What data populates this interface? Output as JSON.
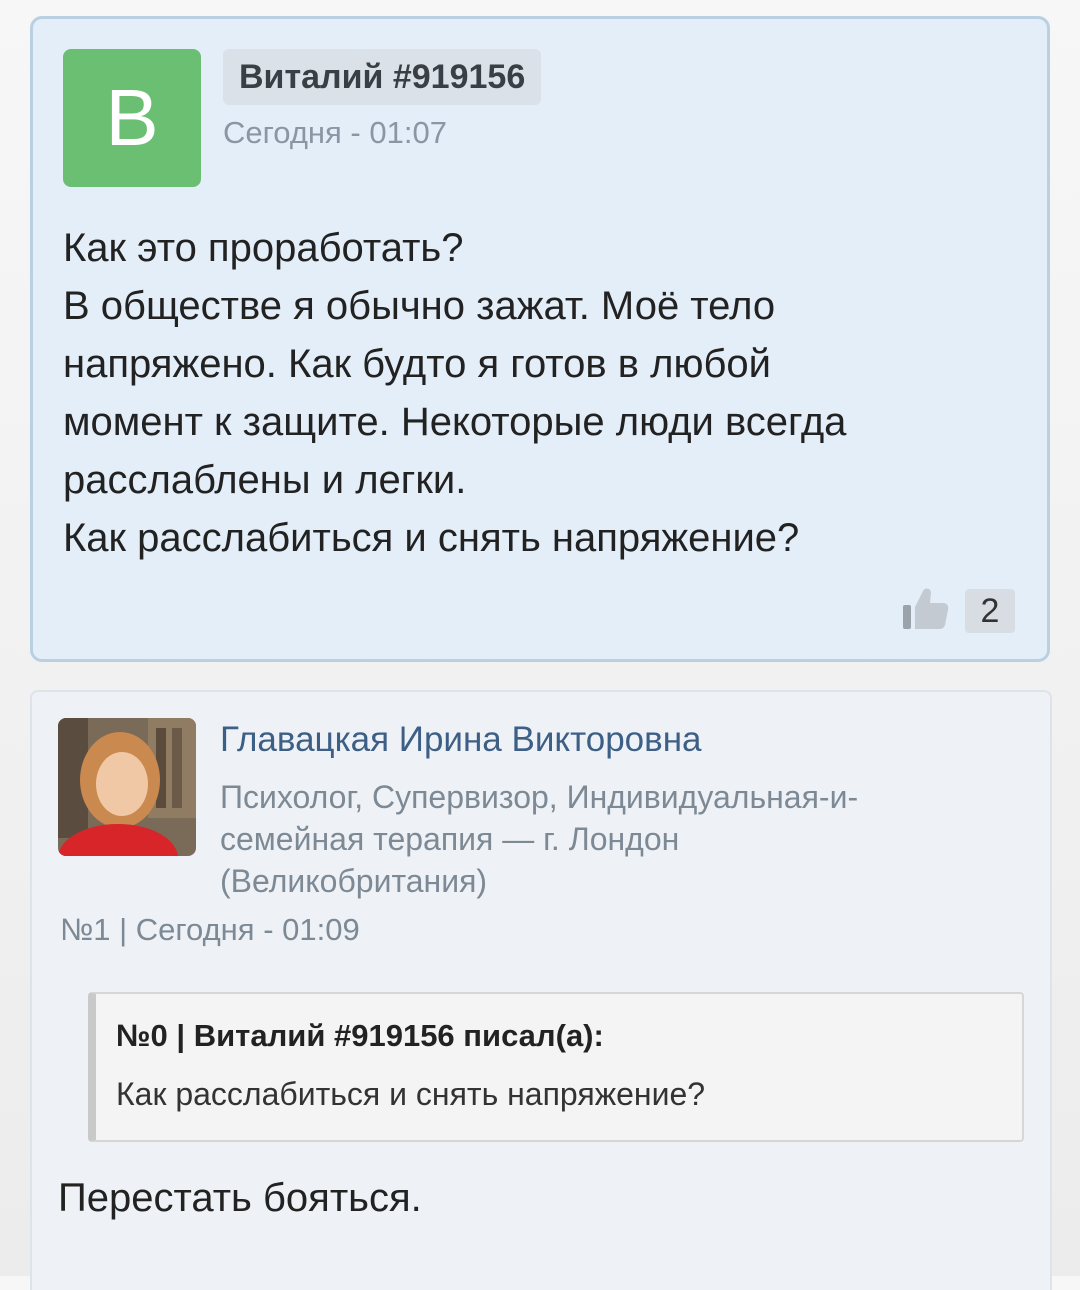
{
  "question": {
    "avatar_letter": "В",
    "author": "Виталий #919156",
    "time": "Сегодня - 01:07",
    "lines": [
      "Как это проработать?",
      "В обществе я обычно зажат. Моё тело",
      "напряжено. Как будто я готов в любой",
      "момент к защите. Некоторые люди всегда",
      "расслаблены и легки.",
      "Как расслабиться и снять напряжение?"
    ],
    "likes": "2"
  },
  "answer": {
    "author_name": "Главацкая Ирина Викторовна",
    "description_lines": [
      "Психолог, Супервизор, Индивидуальная-и-",
      "семейная терапия — г. Лондон",
      "(Великобритания)"
    ],
    "meta": "№1 | Сегодня - 01:09",
    "quote_header": "№0 | Виталий #919156 писал(а):",
    "quote_text": "Как расслабиться и снять напряжение?",
    "text": "Перестать бояться."
  },
  "colors": {
    "question_bg": "#e4eef8",
    "question_border": "#b9cfe2",
    "avatar_green": "#6bbf72",
    "author_link": "#3d5f86",
    "muted": "#7d8995"
  },
  "icons": {
    "like": "thumbs-up-icon"
  }
}
